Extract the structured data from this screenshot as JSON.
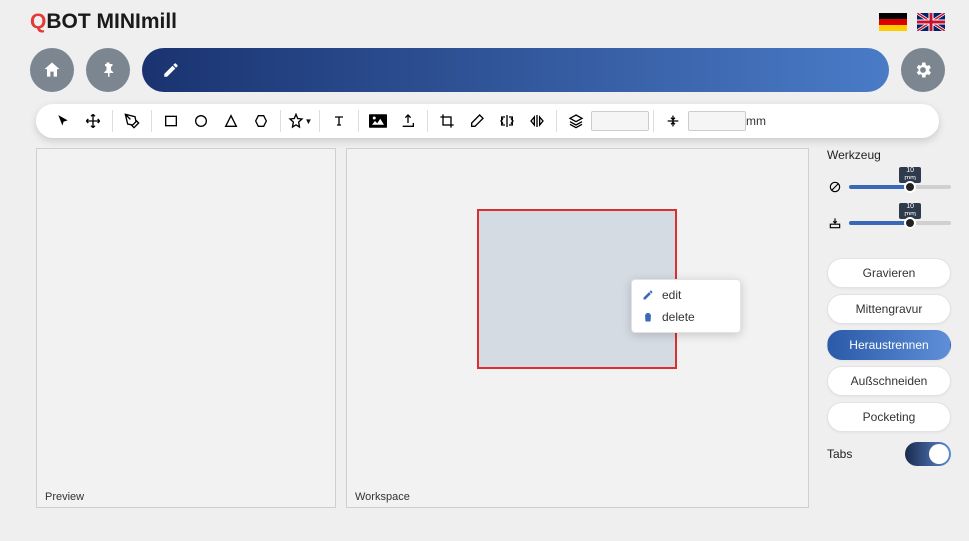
{
  "brand": {
    "q": "Q",
    "bot": "BOT ",
    "mini": "MINI",
    "mill": "mill"
  },
  "toolbar": {
    "unit": "mm"
  },
  "panels": {
    "preview": "Preview",
    "workspace": "Workspace"
  },
  "context_menu": {
    "edit": "edit",
    "delete": "delete"
  },
  "sidebar": {
    "title": "Werkzeug",
    "sliders": [
      {
        "value": "10",
        "unit": "mm"
      },
      {
        "value": "10",
        "unit": "mm"
      }
    ],
    "ops": [
      {
        "label": "Gravieren",
        "active": false
      },
      {
        "label": "Mittengravur",
        "active": false
      },
      {
        "label": "Heraustrennen",
        "active": true
      },
      {
        "label": "Außschneiden",
        "active": false
      },
      {
        "label": "Pocketing",
        "active": false
      }
    ],
    "tabs_label": "Tabs"
  }
}
